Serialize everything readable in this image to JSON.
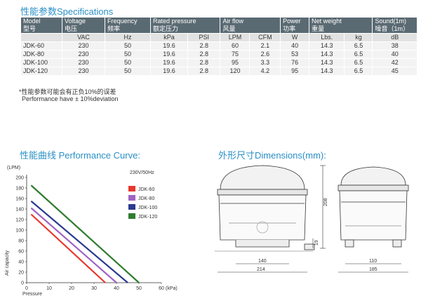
{
  "specs": {
    "title": "性能参数Specifications",
    "headers": [
      {
        "en": "Model",
        "cn": "型号"
      },
      {
        "en": "Voltage",
        "cn": "电压"
      },
      {
        "en": "Frequency",
        "cn": "频率"
      },
      {
        "en": "Rated pressure",
        "cn": "额定压力"
      },
      {
        "en": "Air flow",
        "cn": "风量"
      },
      {
        "en": "Power",
        "cn": "功率"
      },
      {
        "en": "Net weight",
        "cn": "重量"
      },
      {
        "en": "Sound(1m)",
        "cn": "噪音（1m）"
      }
    ],
    "units": [
      "",
      "VAC",
      "Hz",
      "kPa",
      "PSI",
      "LPM",
      "CFM",
      "W",
      "Lbs.",
      "kg",
      "dB"
    ],
    "rows": [
      [
        "JDK-60",
        "230",
        "50",
        "19.6",
        "2.8",
        "60",
        "2.1",
        "40",
        "14.3",
        "6.5",
        "38"
      ],
      [
        "JDK-80",
        "230",
        "50",
        "19.6",
        "2.8",
        "75",
        "2.6",
        "53",
        "14.3",
        "6.5",
        "40"
      ],
      [
        "JDK-100",
        "230",
        "50",
        "19.6",
        "2.8",
        "95",
        "3.3",
        "76",
        "14.3",
        "6.5",
        "42"
      ],
      [
        "JDK-120",
        "230",
        "50",
        "19.6",
        "2.8",
        "120",
        "4.2",
        "95",
        "14.3",
        "6.5",
        "45"
      ]
    ],
    "note_cn": "*性能参数可能会有正负10%的误差",
    "note_en": "Performance have ± 10%deviation"
  },
  "performance": {
    "title": "性能曲线 Performance Curve:",
    "condition": "230V/50Hz"
  },
  "chart_data": {
    "type": "line",
    "title": "",
    "xlabel": "Pressure",
    "ylabel": "Air capacity",
    "x_unit": "(kPa)",
    "y_unit": "(LPM)",
    "xlim": [
      0,
      60
    ],
    "ylim": [
      0,
      200
    ],
    "x_ticks": [
      0,
      10,
      20,
      30,
      40,
      50,
      60
    ],
    "y_ticks": [
      0,
      20,
      40,
      60,
      80,
      100,
      120,
      140,
      160,
      180,
      200
    ],
    "grid": false,
    "legend_position": "top-right",
    "series": [
      {
        "name": "JDK-60",
        "color": "#e8372b",
        "x": [
          2,
          35
        ],
        "y": [
          130,
          0
        ]
      },
      {
        "name": "JDK-80",
        "color": "#a063c4",
        "x": [
          2,
          40
        ],
        "y": [
          142,
          0
        ]
      },
      {
        "name": "JDK-100",
        "color": "#2a3a8f",
        "x": [
          2,
          45
        ],
        "y": [
          155,
          0
        ]
      },
      {
        "name": "JDK-120",
        "color": "#2e7d2e",
        "x": [
          2,
          50
        ],
        "y": [
          185,
          0
        ]
      }
    ]
  },
  "dimensions": {
    "title": "外形尺寸Dimensions(mm):",
    "front": {
      "height": "208",
      "small": "19",
      "width_inner": "140",
      "width_total": "214"
    },
    "side": {
      "inner": "110",
      "total": "185"
    }
  }
}
